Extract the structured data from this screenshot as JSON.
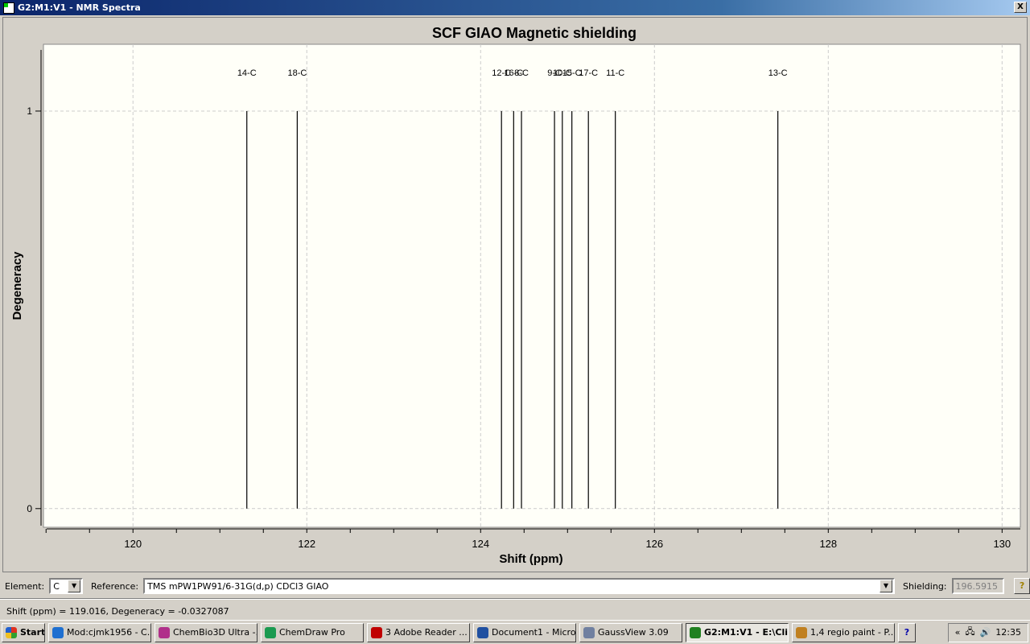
{
  "window": {
    "title": "G2:M1:V1 - NMR Spectra",
    "close": "X"
  },
  "chart_data": {
    "type": "bar",
    "title": "SCF GIAO Magnetic shielding",
    "xlabel": "Shift (ppm)",
    "ylabel": "Degeneracy",
    "xlim": [
      118.97,
      130.21
    ],
    "ylim": [
      -0.047,
      1.168
    ],
    "xticks": [
      120,
      122,
      124,
      126,
      128,
      130
    ],
    "yticks": [
      0,
      1
    ],
    "grid": true,
    "peaks": [
      {
        "label": "14-C",
        "x": 121.31,
        "y": 1
      },
      {
        "label": "18-C",
        "x": 121.89,
        "y": 1
      },
      {
        "label": "12-C",
        "x": 124.24,
        "y": 1
      },
      {
        "label": "16-C",
        "x": 124.38,
        "y": 1
      },
      {
        "label": "8-C",
        "x": 124.47,
        "y": 1
      },
      {
        "label": "9-C",
        "x": 124.85,
        "y": 1
      },
      {
        "label": "10-C",
        "x": 124.94,
        "y": 1
      },
      {
        "label": "15-C",
        "x": 125.05,
        "y": 1
      },
      {
        "label": "17-C",
        "x": 125.24,
        "y": 1
      },
      {
        "label": "11-C",
        "x": 125.55,
        "y": 1
      },
      {
        "label": "13-C",
        "x": 127.42,
        "y": 1
      }
    ]
  },
  "controls": {
    "element_label": "Element:",
    "element_value": "C",
    "reference_label": "Reference:",
    "reference_value": "TMS mPW1PW91/6-31G(d,p) CDCl3 GIAO",
    "shielding_label": "Shielding:",
    "shielding_value": "196.5915",
    "help": "?"
  },
  "status": "Shift (ppm) = 119.016,  Degeneracy = -0.0327087",
  "taskbar": {
    "start": "Start",
    "items": [
      {
        "label": "Mod:cjmk1956 - C...",
        "color": "#1e6fd0"
      },
      {
        "label": "ChemBio3D Ultra -...",
        "color": "#b0308a"
      },
      {
        "label": "ChemDraw Pro",
        "color": "#1a9a50"
      },
      {
        "label": "3  Adobe Reader ...",
        "color": "#c00000"
      },
      {
        "label": "Document1 - Micro...",
        "color": "#2050a0"
      },
      {
        "label": "GaussView 3.09",
        "color": "#7080a0"
      },
      {
        "label": "G2:M1:V1 - E:\\Cli...",
        "color": "#208020",
        "active": true
      },
      {
        "label": "1,4 regio paint - P...",
        "color": "#c08020"
      }
    ],
    "clock": "12:35"
  }
}
